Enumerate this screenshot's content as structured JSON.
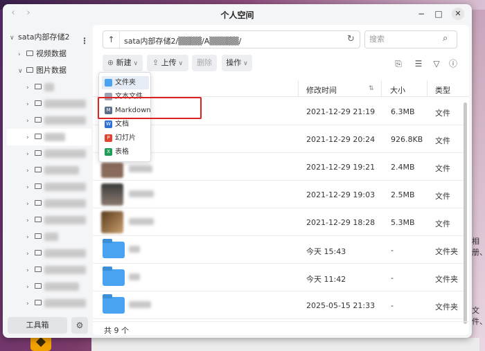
{
  "window": {
    "title": "个人空间"
  },
  "window_controls": {
    "minimize": "−",
    "maximize": "□",
    "close": "✕"
  },
  "sidebar": {
    "root": "sata内部存储2",
    "items": [
      {
        "label": "视频数据"
      },
      {
        "label": "图片数据"
      }
    ],
    "toolbox_label": "工具箱"
  },
  "path": {
    "text": "sata内部存储2/▒▒▒▒/A▒▒▒▒▒/"
  },
  "search": {
    "placeholder": "搜索"
  },
  "toolbar": {
    "new_label": "新建",
    "upload_label": "上传",
    "delete_label": "删除",
    "ops_label": "操作"
  },
  "menu": {
    "items": [
      {
        "label": "文件夹",
        "icon": "folder-icon",
        "color": "#4aa3f0"
      },
      {
        "label": "文本文件",
        "icon": "text-file-icon",
        "color": "#9aa4b2"
      },
      {
        "label": "Markdown",
        "icon": "markdown-icon",
        "color": "#5a6f8c"
      },
      {
        "label": "文档",
        "icon": "word-icon",
        "color": "#2f6fd8"
      },
      {
        "label": "幻灯片",
        "icon": "ppt-icon",
        "color": "#e0452f"
      },
      {
        "label": "表格",
        "icon": "excel-icon",
        "color": "#1f9d55"
      }
    ]
  },
  "table": {
    "headers": {
      "name": "",
      "mtime": "修改时间",
      "size": "大小",
      "type": "类型"
    },
    "rows": [
      {
        "mtime": "2021-12-29 21:19",
        "size": "6.3MB",
        "type": "文件"
      },
      {
        "mtime": "2021-12-29 20:24",
        "size": "926.8KB",
        "type": "文件"
      },
      {
        "mtime": "2021-12-29 19:21",
        "size": "2.4MB",
        "type": "文件"
      },
      {
        "mtime": "2021-12-29 19:03",
        "size": "2.5MB",
        "type": "文件"
      },
      {
        "mtime": "2021-12-29 18:28",
        "size": "5.3MB",
        "type": "文件"
      },
      {
        "mtime": "今天 15:43",
        "size": "-",
        "type": "文件夹"
      },
      {
        "mtime": "今天 11:42",
        "size": "-",
        "type": "文件夹"
      },
      {
        "mtime": "2025-05-15 21:33",
        "size": "-",
        "type": "文件夹"
      }
    ],
    "footer": "共 9 个"
  },
  "bleed": {
    "line1": "相册、",
    "line2": "文件、"
  }
}
